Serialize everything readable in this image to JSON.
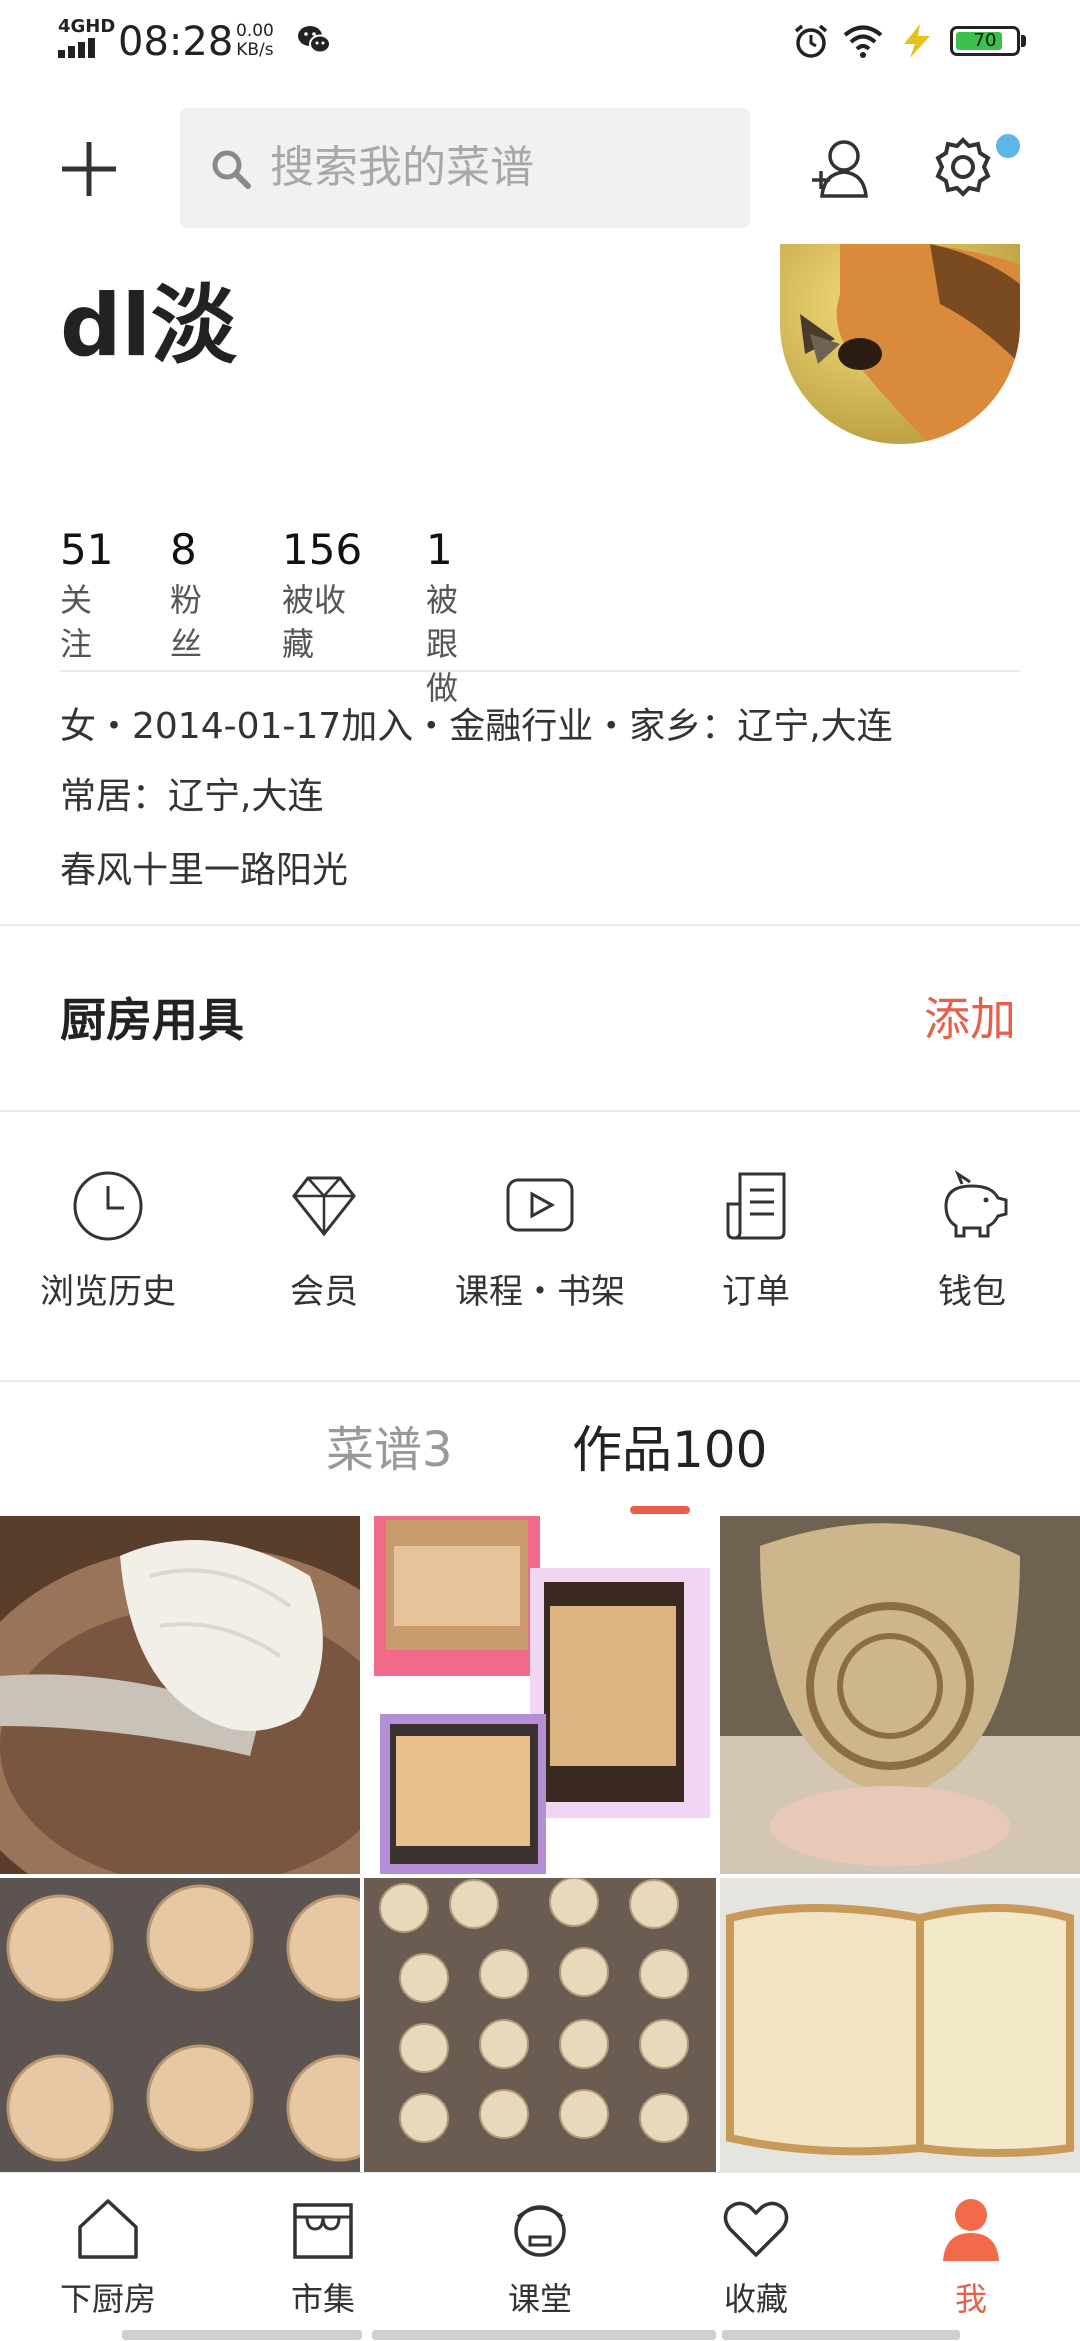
{
  "status_bar": {
    "network": "4GHD",
    "time": "08:28",
    "speed_value": "0.00",
    "speed_unit": "KB/s",
    "battery": "70",
    "battery_color": "#3dbf4b"
  },
  "header": {
    "search_placeholder": "搜索我的菜谱",
    "notify_dot_color": "#5cb6e8"
  },
  "profile": {
    "username": "dl淡",
    "stats": [
      {
        "value": "51",
        "label": "关注"
      },
      {
        "value": "8",
        "label": "粉丝"
      },
      {
        "value": "156",
        "label": "被收藏"
      },
      {
        "value": "1",
        "label": "被跟做"
      }
    ],
    "info_line1": "女・2014-01-17加入・金融行业・家乡：辽宁,大连",
    "info_line2": "常居：辽宁,大连",
    "bio": "春风十里一路阳光"
  },
  "kitchen": {
    "title": "厨房用具",
    "add_label": "添加",
    "accent": "#e8604a"
  },
  "quick_menu": [
    {
      "icon": "clock-icon",
      "label": "浏览历史"
    },
    {
      "icon": "diamond-icon",
      "label": "会员"
    },
    {
      "icon": "play-icon",
      "label": "课程・书架"
    },
    {
      "icon": "order-icon",
      "label": "订单"
    },
    {
      "icon": "piggy-bank-icon",
      "label": "钱包"
    }
  ],
  "tabs": [
    {
      "label": "菜谱3",
      "active": false
    },
    {
      "label": "作品100",
      "active": true
    }
  ],
  "bottom_nav": [
    {
      "icon": "home-icon",
      "label": "下厨房",
      "active": false
    },
    {
      "icon": "market-icon",
      "label": "市集",
      "active": false
    },
    {
      "icon": "classroom-icon",
      "label": "课堂",
      "active": false
    },
    {
      "icon": "heart-icon",
      "label": "收藏",
      "active": false
    },
    {
      "icon": "user-icon",
      "label": "我",
      "active": true
    }
  ]
}
